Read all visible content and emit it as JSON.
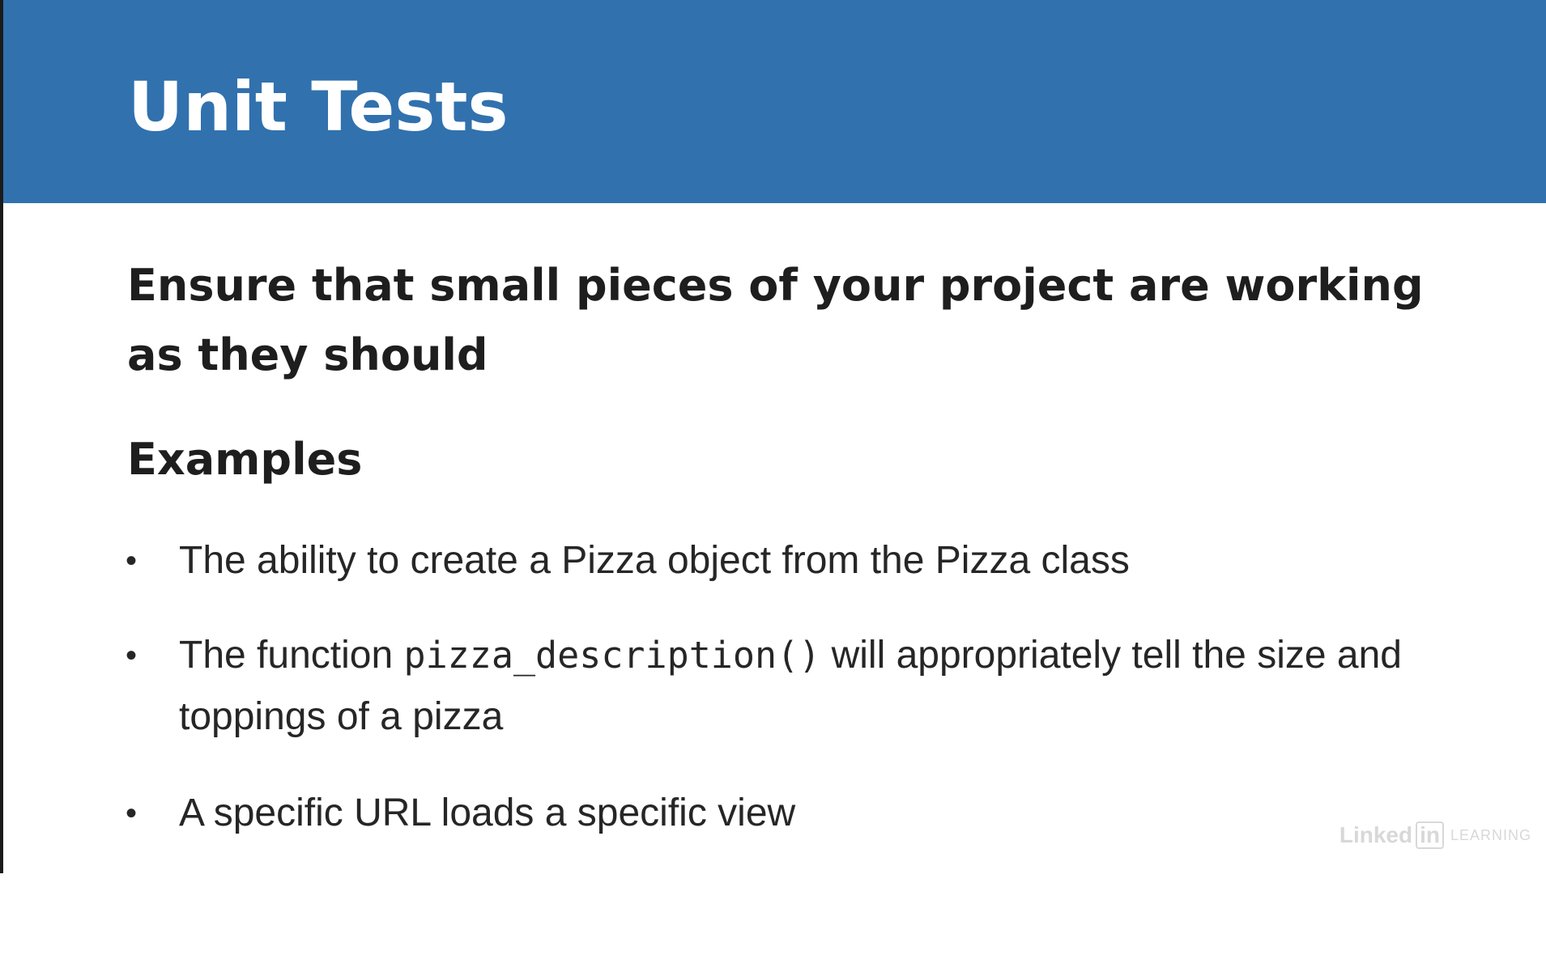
{
  "slide": {
    "title": "Unit Tests",
    "lead": "Ensure that small pieces of your project are working as they should",
    "examples_heading": "Examples",
    "bullet_symbol": "•",
    "items": [
      {
        "text": "The ability to create a Pizza object from the Pizza class"
      },
      {
        "before": "The function ",
        "code": "pizza_description()",
        "after": " will appropriately tell the size and toppings of a pizza"
      },
      {
        "text": "A specific URL loads a specific view"
      }
    ]
  },
  "watermark": {
    "part1": "Linked",
    "part2": "in",
    "part3": "LEARNING"
  },
  "colors": {
    "header_blue": "#3171ae",
    "title_white": "#ffffff",
    "body_text": "#1e1e1e",
    "watermark_gray": "#d8d8d8"
  }
}
